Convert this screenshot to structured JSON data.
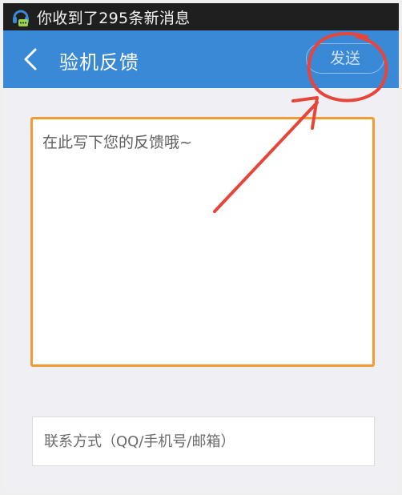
{
  "status_bar": {
    "notification_icon": "chat-bubble-notification-icon",
    "notification_text": "你收到了295条新消息",
    "background": "#1f1f1f"
  },
  "title_bar": {
    "back_icon": "chevron-left-icon",
    "title": "验机反馈",
    "send_label": "发送",
    "background": "#3a89d6"
  },
  "feedback": {
    "placeholder": "在此写下您的反馈哦~",
    "value": "",
    "border_color": "#f39a33"
  },
  "contact": {
    "placeholder": "联系方式（QQ/手机号/邮箱）",
    "value": ""
  },
  "annotation": {
    "color": "#e8453a",
    "shapes": [
      "hand-drawn-circle",
      "hand-drawn-arrow"
    ]
  }
}
